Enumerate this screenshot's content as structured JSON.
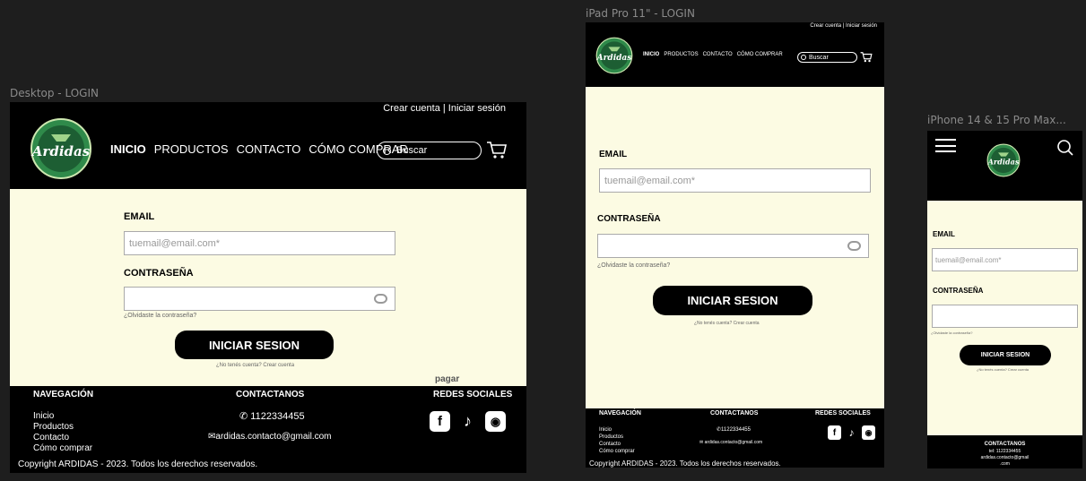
{
  "frames": {
    "desktop": "Desktop - LOGIN",
    "ipad": "iPad Pro 11\" - LOGIN",
    "iphone": "iPhone 14 & 15 Pro Max..."
  },
  "header": {
    "account_links": "Crear cuenta | Iniciar sesión",
    "logo_text": "Ardidas",
    "nav": [
      "INICIO",
      "PRODUCTOS",
      "CONTACTO",
      "CÓMO COMPRAR"
    ],
    "search_placeholder": "Buscar"
  },
  "login": {
    "email_label": "EMAIL",
    "email_placeholder": "tuemail@email.com*",
    "password_label": "CONTRASEÑA",
    "forgot": "¿Olvidaste la contraseña?",
    "submit": "INICIAR SESION",
    "no_account": "¿No tenés cuenta? Crear cuenta"
  },
  "pagar": "pagar",
  "footer": {
    "nav_title": "NAVEGACIÓN",
    "nav_items": [
      "Inicio",
      "Productos",
      "Contacto",
      "Cómo comprar"
    ],
    "contact_title": "CONTACTANOS",
    "phone": "1122334455",
    "email": "ardidas.contacto@gmail.com",
    "social_title": "REDES SOCIALES",
    "social_icons": [
      "facebook-icon",
      "tiktok-icon",
      "instagram-icon"
    ],
    "copyright": "Copyright ARDIDAS - 2023. Todos los derechos reservados.",
    "mobile_phone": "tel: 1122334455",
    "mobile_email_1": "ardidas.contacto@gmail",
    "mobile_email_2": ".com"
  },
  "colors": {
    "cream": "#fcfbe3",
    "black": "#000000",
    "logo_green": "#2f8a4a"
  }
}
